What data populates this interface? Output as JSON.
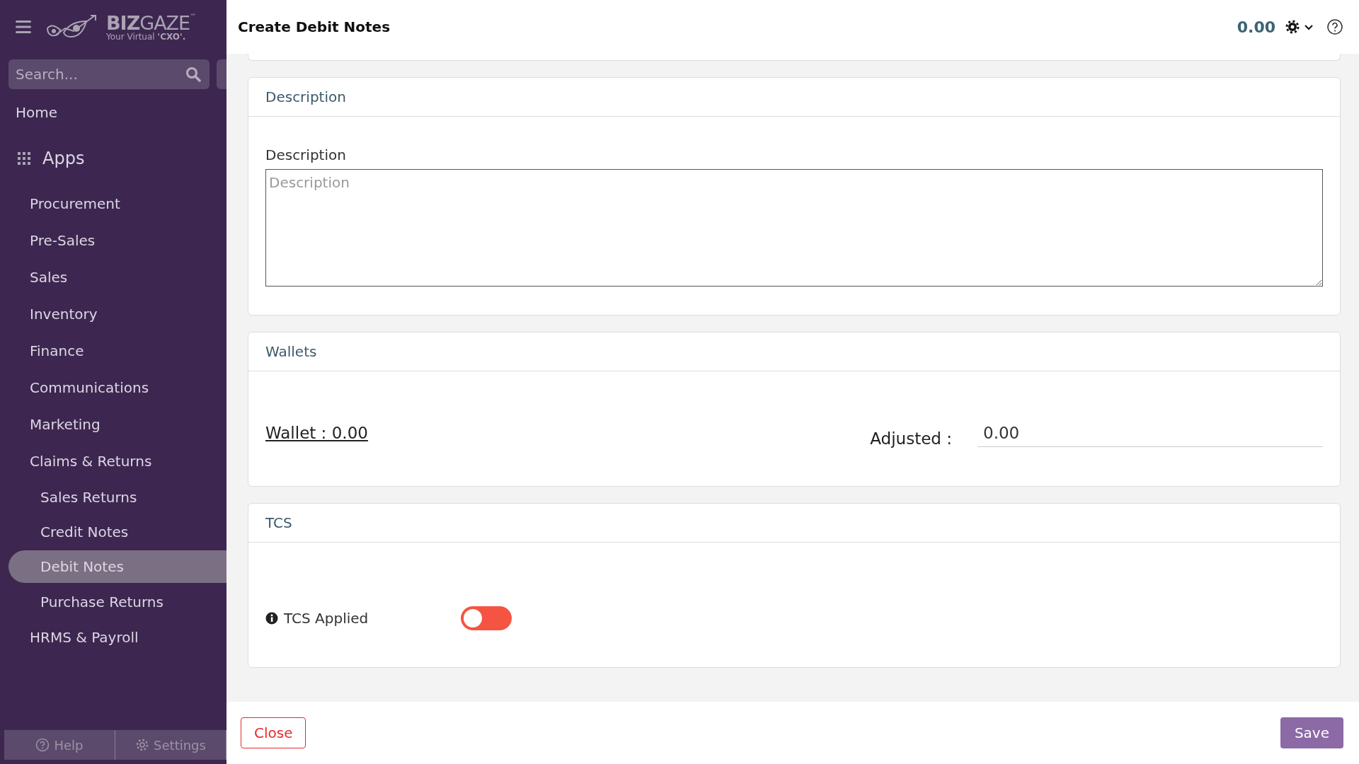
{
  "sidebar": {
    "logo": {
      "brand_bold": "BIZ",
      "brand": "GAZE",
      "trademark": "™",
      "tagline": "Your Virtual ",
      "tagline_bold": "'CXO'."
    },
    "search": {
      "placeholder": "Search..."
    },
    "home": {
      "label": "Home",
      "selected": false
    },
    "apps": {
      "label": "Apps",
      "children": [
        {
          "label": "Procurement",
          "selected": false
        },
        {
          "label": "Pre-Sales",
          "selected": false
        },
        {
          "label": "Sales",
          "selected": false
        },
        {
          "label": "Inventory",
          "selected": false
        },
        {
          "label": "Finance",
          "selected": false
        },
        {
          "label": "Communications",
          "selected": false
        },
        {
          "label": "Marketing",
          "selected": false
        },
        {
          "label": "Claims & Returns",
          "selected": false,
          "children": [
            {
              "label": "Sales Returns",
              "selected": false
            },
            {
              "label": "Credit Notes",
              "selected": false
            },
            {
              "label": "Debit Notes",
              "selected": true
            },
            {
              "label": "Purchase Returns",
              "selected": false
            }
          ]
        },
        {
          "label": "HRMS & Payroll",
          "selected": false
        }
      ]
    },
    "footer": [
      {
        "label": "Help",
        "kind": "help"
      },
      {
        "label": "Settings",
        "kind": "settings"
      }
    ]
  },
  "header": {
    "title": "Create Debit Notes",
    "total": "0.00"
  },
  "description_section": {
    "title": "Description",
    "label": "Description",
    "placeholder": "Description"
  },
  "wallets_section": {
    "title": "Wallets",
    "wallet_link": "Wallet : 0.00",
    "adjusted_label": "Adjusted :",
    "adjusted_value": "0.00"
  },
  "tcs_section": {
    "title": "TCS",
    "label": "TCS Applied",
    "on": false
  },
  "buttons": {
    "close": "Close",
    "save": "Save"
  }
}
